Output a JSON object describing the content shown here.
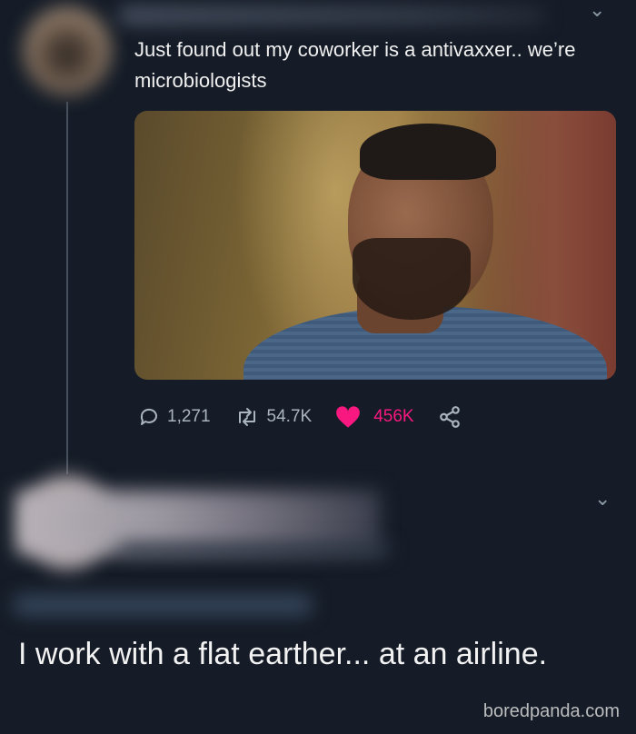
{
  "tweet": {
    "text": "Just found out my coworker is a antivaxxer.. we’re microbiologists",
    "replies": "1,271",
    "retweets": "54.7K",
    "likes": "456K"
  },
  "reply": {
    "text": "I work with a flat earther... at an airline."
  },
  "watermark": "boredpanda.com",
  "icons": {
    "menu": "chevron-down-icon",
    "reply": "speech-bubble-icon",
    "retweet": "retweet-icon",
    "like": "heart-icon",
    "share": "share-icon"
  },
  "colors": {
    "background": "#151c27",
    "like": "#f91880",
    "muted": "#aab4be"
  }
}
